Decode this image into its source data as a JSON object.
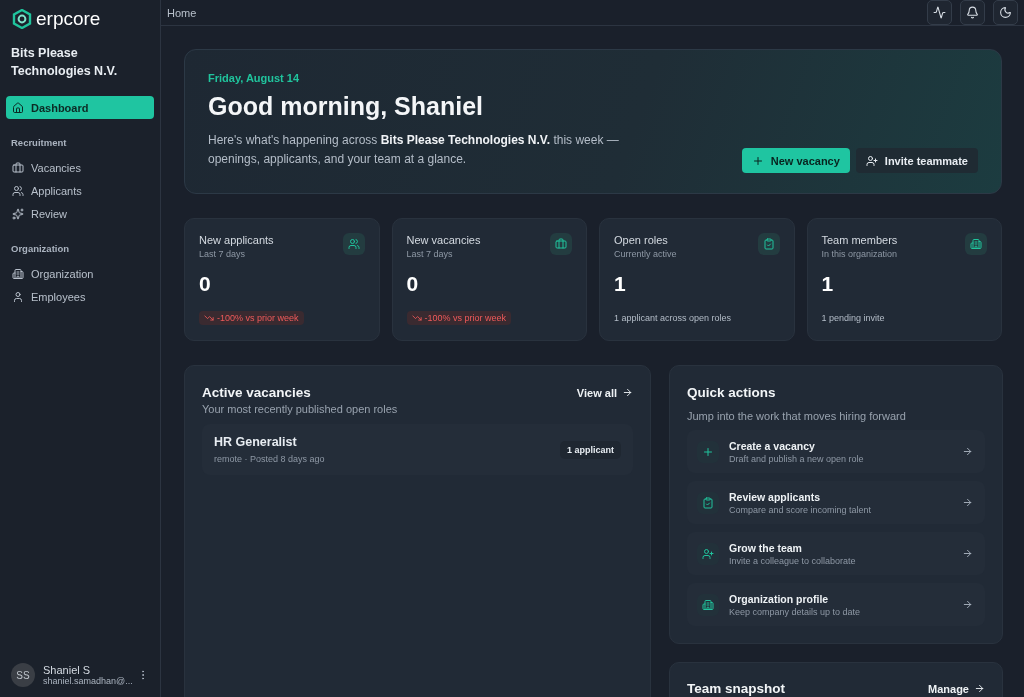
{
  "brand": {
    "name": "erpcore",
    "org": "Bits Please Technologies N.V."
  },
  "sidebar": {
    "sections": [
      {
        "items": [
          {
            "label": "Dashboard",
            "selected": true
          }
        ]
      },
      {
        "title": "Recruitment",
        "items": [
          {
            "label": "Vacancies",
            "selected": false
          },
          {
            "label": "Applicants",
            "selected": false
          },
          {
            "label": "Review",
            "selected": false
          }
        ]
      },
      {
        "title": "Organization",
        "items": [
          {
            "label": "Organization",
            "selected": false
          },
          {
            "label": "Employees",
            "selected": false
          }
        ]
      }
    ],
    "user": {
      "initials": "SS",
      "name": "Shaniel S",
      "email": "shaniel.samadhan@..."
    }
  },
  "topbar": {
    "breadcrumb": "Home"
  },
  "hero": {
    "date": "Friday, August 14",
    "greeting": "Good morning, Shaniel",
    "text": "Here's what's happening across **Bits Please Technologies N.V.** this week — openings, applicants, and your team at a glance.",
    "primary": "New vacancy",
    "secondary": "Invite teammate"
  },
  "stats": [
    {
      "title": "New applicants",
      "subtitle": "Last 7 days",
      "value": "0",
      "kind": "trend",
      "note": "-100% vs prior week"
    },
    {
      "title": "New vacancies",
      "subtitle": "Last 7 days",
      "value": "0",
      "kind": "trend",
      "note": "-100% vs prior week"
    },
    {
      "title": "Open roles",
      "subtitle": "Currently active",
      "value": "1",
      "kind": "note",
      "note": "1 applicant across open roles"
    },
    {
      "title": "Team members",
      "subtitle": "In this organization",
      "value": "1",
      "kind": "note",
      "note": "1 pending invite"
    }
  ],
  "active_vacancies": {
    "title": "Active vacancies",
    "subtitle": "Your most recently published open roles",
    "link": "View all",
    "rows": [
      {
        "title": "HR Generalist",
        "meta": "remote · Posted 8 days ago",
        "badge": "1 applicant"
      }
    ]
  },
  "quick_actions": {
    "title": "Quick actions",
    "subtitle": "Jump into the work that moves hiring forward",
    "items": [
      {
        "title": "Create a vacancy",
        "subtitle": "Draft and publish a new open role"
      },
      {
        "title": "Review applicants",
        "subtitle": "Compare and score incoming talent"
      },
      {
        "title": "Grow the team",
        "subtitle": "Invite a colleague to collaborate"
      },
      {
        "title": "Organization profile",
        "subtitle": "Keep company details up to date"
      }
    ]
  },
  "team_snapshot": {
    "title": "Team snapshot",
    "link": "Manage"
  }
}
